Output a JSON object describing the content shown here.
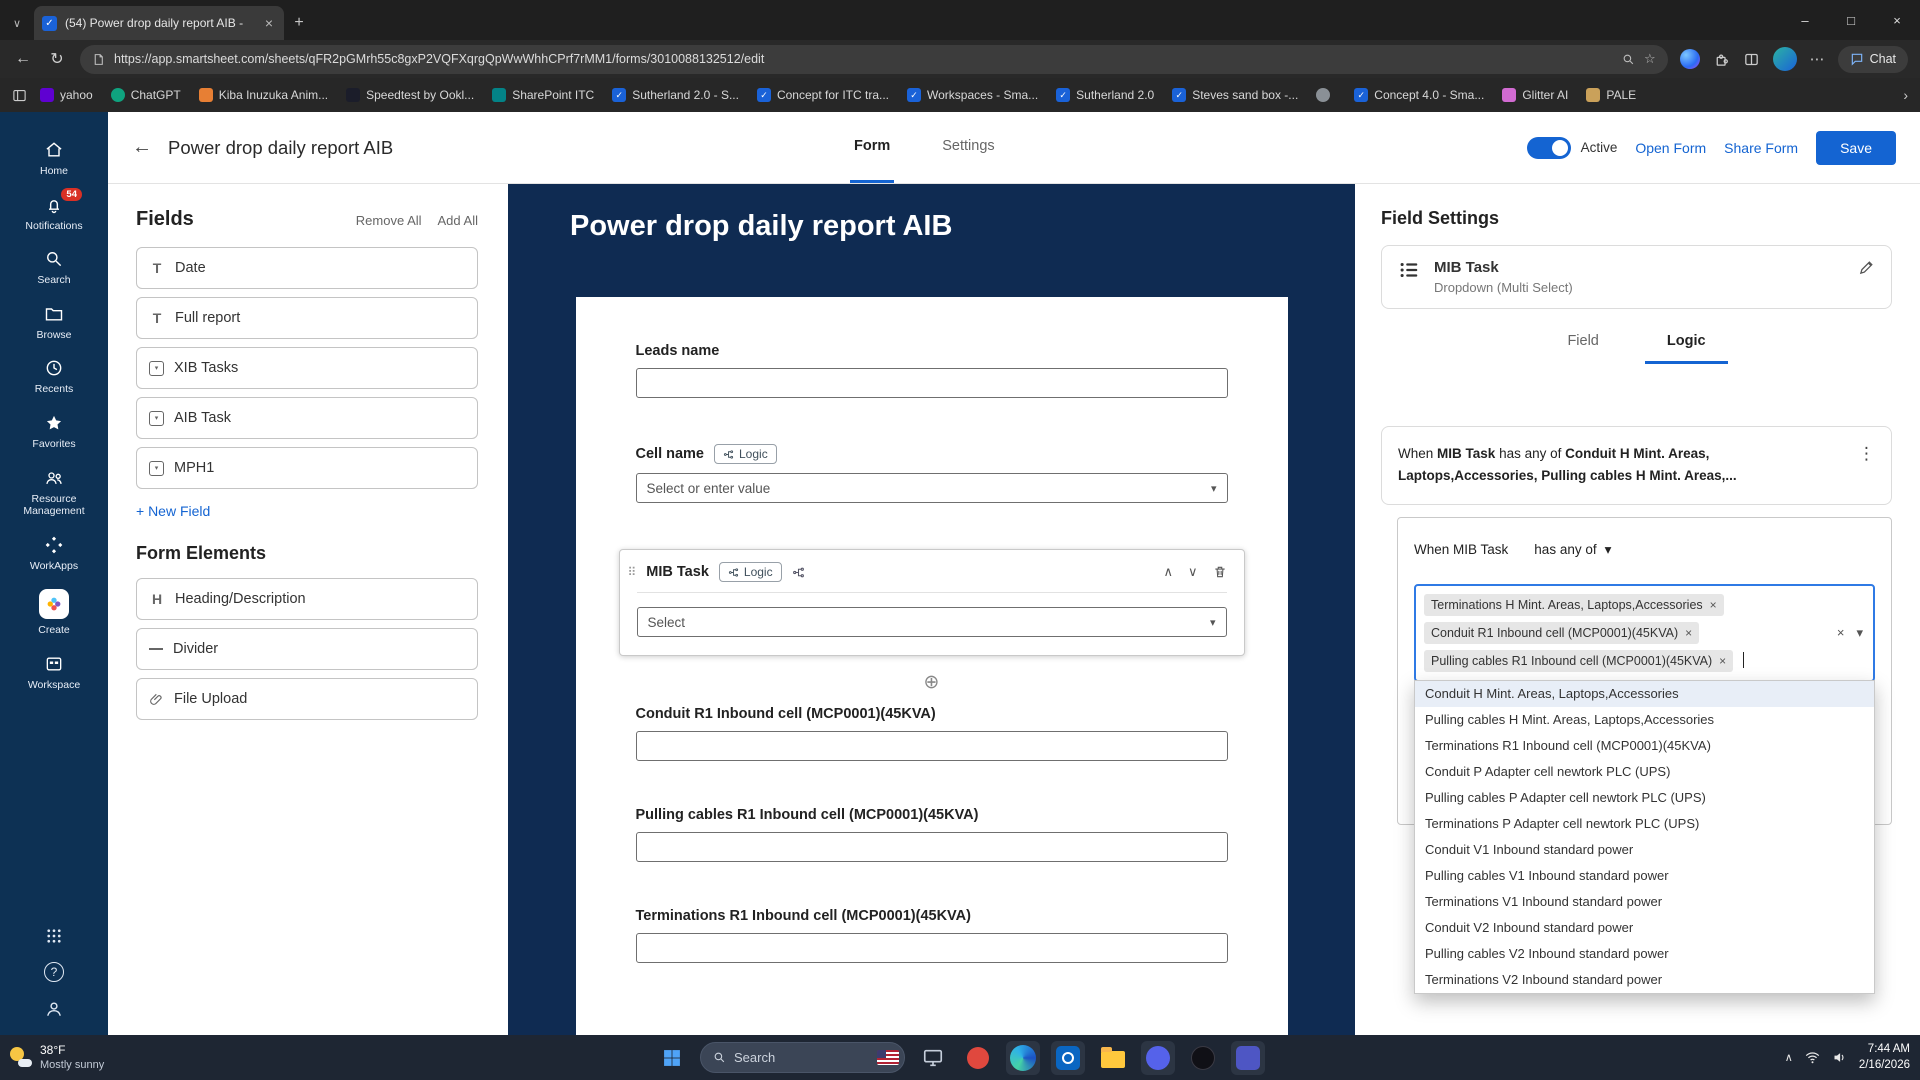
{
  "colors": {
    "accent": "#1464d2",
    "form_navy": "#0f2b52",
    "nav_blue": "#0d3154",
    "badge_red": "#d93025",
    "chip_focus": "#2f7ae5"
  },
  "icons": {
    "close": "×",
    "win_min": "–",
    "win_max": "□",
    "back": "←",
    "refresh": "↻",
    "star": "☆",
    "caret": "▾",
    "chevron_up": "∧",
    "chevron_down": "∨",
    "chevron_right": "›",
    "chevron_small": "∨",
    "kebab": "⋮",
    "ellipsis": "⋯",
    "plus": "+",
    "plus_circle": "⊕",
    "drag": "⠿",
    "help": "?",
    "text_t": "T",
    "heading_h": "H",
    "check": "✓"
  },
  "browser": {
    "tab_title": "(54) Power drop daily report AIB -",
    "url": "https://app.smartsheet.com/sheets/qFR2pGMrh55c8gxP2VQFXqrgQpWwWhhCPrf7rMM1/forms/3010088132512/edit",
    "chat": "Chat",
    "bookmarks": [
      {
        "label": "yahoo",
        "bg": "#5f01d1",
        "mark": ""
      },
      {
        "label": "ChatGPT",
        "bg": "#0fa37f",
        "mark": ""
      },
      {
        "label": "Kiba Inuzuka Anim...",
        "bg": "#e77f34",
        "mark": ""
      },
      {
        "label": "Speedtest by Ookl...",
        "bg": "#1b1d2a",
        "mark": ""
      },
      {
        "label": "SharePoint ITC",
        "bg": "#038387",
        "mark": ""
      },
      {
        "label": "Sutherland 2.0 - S...",
        "bg": "#1a62d8",
        "mark": "✓"
      },
      {
        "label": "Concept for ITC tra...",
        "bg": "#1a62d8",
        "mark": "✓"
      },
      {
        "label": "Workspaces - Sma...",
        "bg": "#1a62d8",
        "mark": "✓"
      },
      {
        "label": "Sutherland 2.0",
        "bg": "#1a62d8",
        "mark": "✓"
      },
      {
        "label": "Steves sand box -...",
        "bg": "#1a62d8",
        "mark": "✓"
      },
      {
        "label": "",
        "bg": "#8a9096",
        "mark": ""
      },
      {
        "label": "Concept 4.0 - Sma...",
        "bg": "#1a62d8",
        "mark": "✓"
      },
      {
        "label": "Glitter AI",
        "bg": "#d26bd2",
        "mark": ""
      },
      {
        "label": "PALE",
        "bg": "#caa15a",
        "mark": ""
      }
    ]
  },
  "sidebar": {
    "items": [
      {
        "label": "Home"
      },
      {
        "label": "Notifications",
        "badge": "54"
      },
      {
        "label": "Search"
      },
      {
        "label": "Browse"
      },
      {
        "label": "Recents"
      },
      {
        "label": "Favorites"
      },
      {
        "label": "Resource Management"
      },
      {
        "label": "WorkApps"
      },
      {
        "label": "Create"
      },
      {
        "label": "Workspace"
      }
    ]
  },
  "header": {
    "title": "Power drop daily report AIB",
    "tab_form": "Form",
    "tab_settings": "Settings",
    "active": "Active",
    "open_form": "Open Form",
    "share_form": "Share Form",
    "save": "Save"
  },
  "fields_panel": {
    "title": "Fields",
    "remove_all": "Remove All",
    "add_all": "Add All",
    "fields": [
      {
        "label": "Date"
      },
      {
        "label": "Full report"
      },
      {
        "label": "XIB Tasks"
      },
      {
        "label": "AIB Task"
      },
      {
        "label": "MPH1"
      }
    ],
    "new_field": "+ New Field",
    "elements_title": "Form Elements",
    "elements": [
      {
        "label": "Heading/Description"
      },
      {
        "label": "Divider"
      },
      {
        "label": "File Upload"
      }
    ]
  },
  "preview": {
    "title": "Power drop daily report AIB",
    "logic": "Logic",
    "leads_label": "Leads name",
    "cell_label": "Cell name",
    "cell_placeholder": "Select or enter value",
    "mib_label": "MIB Task",
    "mib_placeholder": "Select",
    "conduit_label": "Conduit R1 Inbound cell (MCP0001)(45KVA)",
    "pulling_label": "Pulling cables R1 Inbound cell (MCP0001)(45KVA)",
    "terminations_label": "Terminations R1 Inbound cell (MCP0001)(45KVA)"
  },
  "settings": {
    "title": "Field Settings",
    "field_name": "MIB Task",
    "field_type": "Dropdown (Multi Select)",
    "tab_field": "Field",
    "tab_logic": "Logic",
    "summary_when": "When",
    "summary_field": "MIB Task",
    "summary_op": "has any of",
    "summary_values": "Conduit H Mint. Areas, Laptops,Accessories, Pulling cables H Mint. Areas,...",
    "editor": {
      "when": "When MIB Task",
      "operator": "has any of",
      "chips": [
        {
          "label": "Terminations H Mint. Areas, Laptops,Accessories"
        },
        {
          "label": "Conduit R1 Inbound cell (MCP0001)(45KVA)"
        },
        {
          "label": "Pulling cables R1 Inbound cell (MCP0001)(45KVA)"
        }
      ],
      "options": [
        {
          "label": "Conduit H Mint. Areas, Laptops,Accessories"
        },
        {
          "label": "Pulling cables H Mint. Areas, Laptops,Accessories"
        },
        {
          "label": "Terminations R1 Inbound cell (MCP0001)(45KVA)"
        },
        {
          "label": "Conduit P Adapter cell newtork PLC (UPS)"
        },
        {
          "label": "Pulling cables P Adapter cell newtork PLC (UPS)"
        },
        {
          "label": "Terminations P Adapter cell newtork PLC (UPS)"
        },
        {
          "label": "Conduit V1 Inbound standard power"
        },
        {
          "label": "Pulling cables V1 Inbound standard power"
        },
        {
          "label": "Terminations V1 Inbound standard power"
        },
        {
          "label": "Conduit V2 Inbound standard power"
        },
        {
          "label": "Pulling cables V2 Inbound standard power"
        },
        {
          "label": "Terminations V2 Inbound standard power"
        }
      ]
    }
  },
  "taskbar": {
    "temp": "38°F",
    "weather": "Mostly sunny",
    "search": "Search",
    "time": "7:44 AM",
    "date": "2/16/2026"
  }
}
